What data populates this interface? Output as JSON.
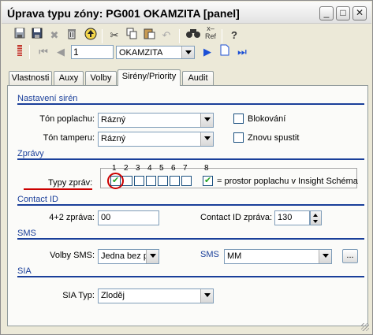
{
  "window": {
    "title": "Úprava typu zóny: PG001 OKAMZITA [panel]",
    "controls": {
      "minimize": "_",
      "maximize": "□",
      "close": "✕"
    }
  },
  "toolbar": {
    "record_number": "1",
    "zone_select": "OKAMZITA",
    "ref_label": "Ref",
    "help_label": "?"
  },
  "tabs": [
    {
      "label": "Vlastnosti"
    },
    {
      "label": "Auxy"
    },
    {
      "label": "Volby"
    },
    {
      "label": "Sirény/Priority"
    },
    {
      "label": "Audit"
    }
  ],
  "sirens": {
    "section_title": "Nastavení sirén",
    "alarm_tone_label": "Tón poplachu:",
    "alarm_tone_value": "Rázný",
    "tamper_tone_label": "Tón tamperu:",
    "tamper_tone_value": "Rázný",
    "blocking_label": "Blokování",
    "restart_label": "Znovu spustit"
  },
  "messages": {
    "section_title": "Zprávy",
    "types_label": "Typy zpráv:",
    "numbers": [
      "1",
      "2",
      "3",
      "4",
      "5",
      "6",
      "7",
      "8"
    ],
    "checked": [
      true,
      false,
      false,
      false,
      false,
      false,
      false,
      true
    ],
    "space_note": "= prostor poplachu v Insight Schéma"
  },
  "contact_id": {
    "section_title": "Contact ID",
    "message_42_label": "4+2 zpráva:",
    "message_42_value": "00",
    "cid_label": "Contact ID zpráva:",
    "cid_value": "130"
  },
  "sms": {
    "section_title": "SMS",
    "options_label": "Volby SMS:",
    "options_value": "Jedna bez p",
    "sms_label": "SMS",
    "sms_value": "MM",
    "browse_label": "..."
  },
  "sia": {
    "section_title": "SIA",
    "type_label": "SIA Typ:",
    "type_value": "Zloděj"
  },
  "colors": {
    "section_text": "#1a3f9a",
    "highlight_red": "#cc0000"
  }
}
